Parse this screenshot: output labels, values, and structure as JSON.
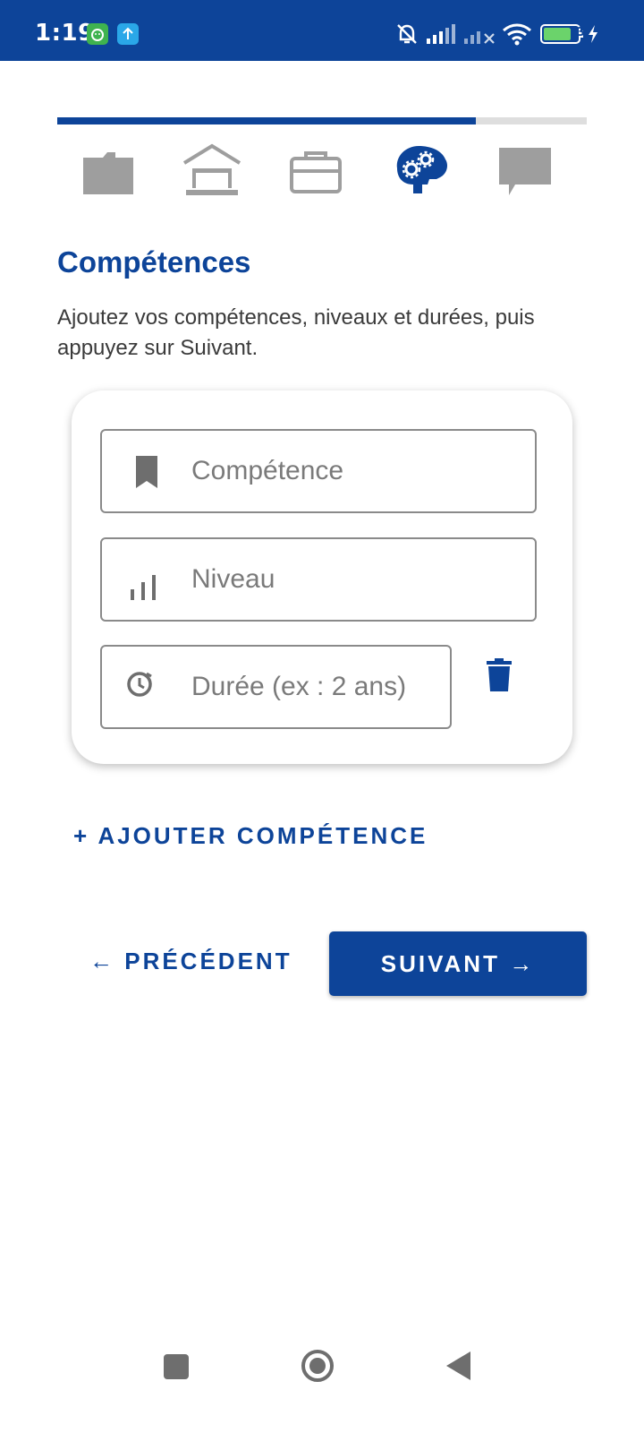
{
  "status_bar": {
    "time": "1:19",
    "battery_level": "73",
    "icons": [
      "notification-app-icon",
      "upload-icon",
      "bell-off-icon",
      "signal-icon",
      "signal-no-service-icon",
      "wifi-icon",
      "battery-icon",
      "charging-icon"
    ]
  },
  "progress": {
    "fraction": 0.79
  },
  "steps": [
    {
      "icon": "folder-icon",
      "active": false
    },
    {
      "icon": "school-icon",
      "active": false
    },
    {
      "icon": "briefcase-icon",
      "active": false
    },
    {
      "icon": "brain-gears-icon",
      "active": true
    },
    {
      "icon": "chat-icon",
      "active": false
    }
  ],
  "page": {
    "title": "Compétences",
    "subtitle": "Ajoutez vos compétences, niveaux et durées, puis appuyez sur Suivant."
  },
  "form": {
    "skill_placeholder": "Compétence",
    "level_placeholder": "Niveau",
    "duration_placeholder": "Durée (ex : 2 ans)"
  },
  "actions": {
    "add_skill": "+ AJOUTER COMPÉTENCE",
    "previous": "← PRÉCÉDENT",
    "next": "SUIVANT →"
  },
  "colors": {
    "primary": "#0D4499",
    "inactive_icon": "#9E9E9E",
    "track": "#DEDEDE"
  }
}
